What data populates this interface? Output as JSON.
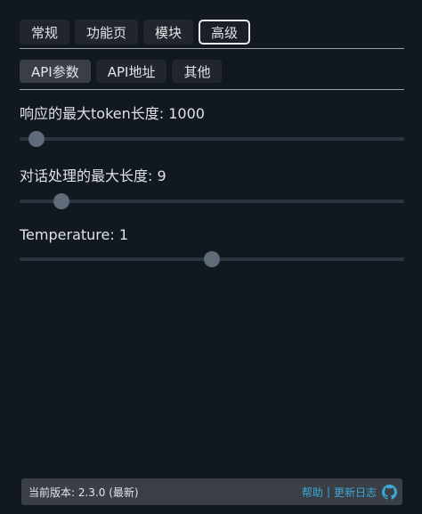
{
  "tabs_main": [
    "常规",
    "功能页",
    "模块",
    "高级"
  ],
  "tabs_sub": [
    "API参数",
    "API地址",
    "其他"
  ],
  "settings": {
    "max_tokens": {
      "label": "响应的最大token长度: 1000",
      "value": 1000,
      "fraction": 0.045
    },
    "max_history": {
      "label": "对话处理的最大长度: 9",
      "value": 9,
      "fraction": 0.108
    },
    "temperature": {
      "label": "Temperature: 1",
      "value": 1,
      "fraction": 0.5
    }
  },
  "footer": {
    "version": "当前版本: 2.3.0 (最新)",
    "help": "帮助",
    "sep": "|",
    "changelog": "更新日志"
  }
}
